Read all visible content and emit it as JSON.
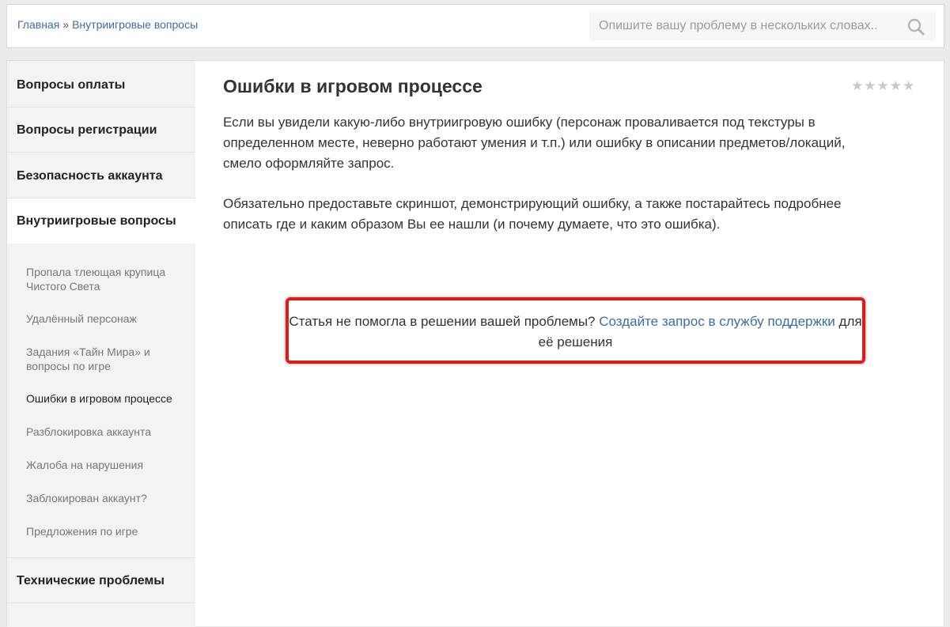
{
  "breadcrumb": {
    "home": "Главная",
    "separator": "»",
    "current": "Внутриигровые вопросы"
  },
  "search": {
    "placeholder": "Опишите вашу проблему в нескольких словах..",
    "value": "",
    "icon": "search-icon"
  },
  "sidebar": {
    "categories": [
      "Вопросы оплаты",
      "Вопросы регистрации",
      "Безопасность аккаунта",
      "Внутриигровые вопросы",
      "Технические проблемы"
    ],
    "active_category": "Внутриигровые вопросы",
    "subitems": [
      "Пропала тлеющая крупица Чистого Света",
      "Удалённый персонаж",
      "Задания «Тайн Мира» и вопросы по игре",
      "Ошибки в игровом процессе",
      "Разблокировка аккаунта",
      "Жалоба на нарушения",
      "Заблокирован аккаунт?",
      "Предложения по игре"
    ],
    "active_subitem": "Ошибки в игровом процессе"
  },
  "article": {
    "title": "Ошибки в игровом процессе",
    "rating": {
      "stars": 5,
      "filled": 0,
      "glyph": "★★★★★"
    },
    "paragraphs": [
      "Если вы увидели какую-либо внутриигровую ошибку (персонаж проваливается под текстуры в определенном месте, неверно работают умения и т.п.) или ошибку в описании предметов/локаций, смело оформляйте запрос.",
      "Обязательно предоставьте скриншот, демонстрирующий ошибку, а также постарайтесь подробнее описать где и каким образом Вы ее нашли (и почему думаете, что это ошибка)."
    ]
  },
  "notice": {
    "text_before": "Статья не помогла в решении вашей проблемы?",
    "link": "Создайте запрос в службу поддержки",
    "text_after": "для её решения",
    "border_color": "#dd1b1b"
  },
  "colors": {
    "link": "#3b6ea5",
    "sidebar_bg": "#f3f3f3",
    "page_bg": "#ececec"
  }
}
